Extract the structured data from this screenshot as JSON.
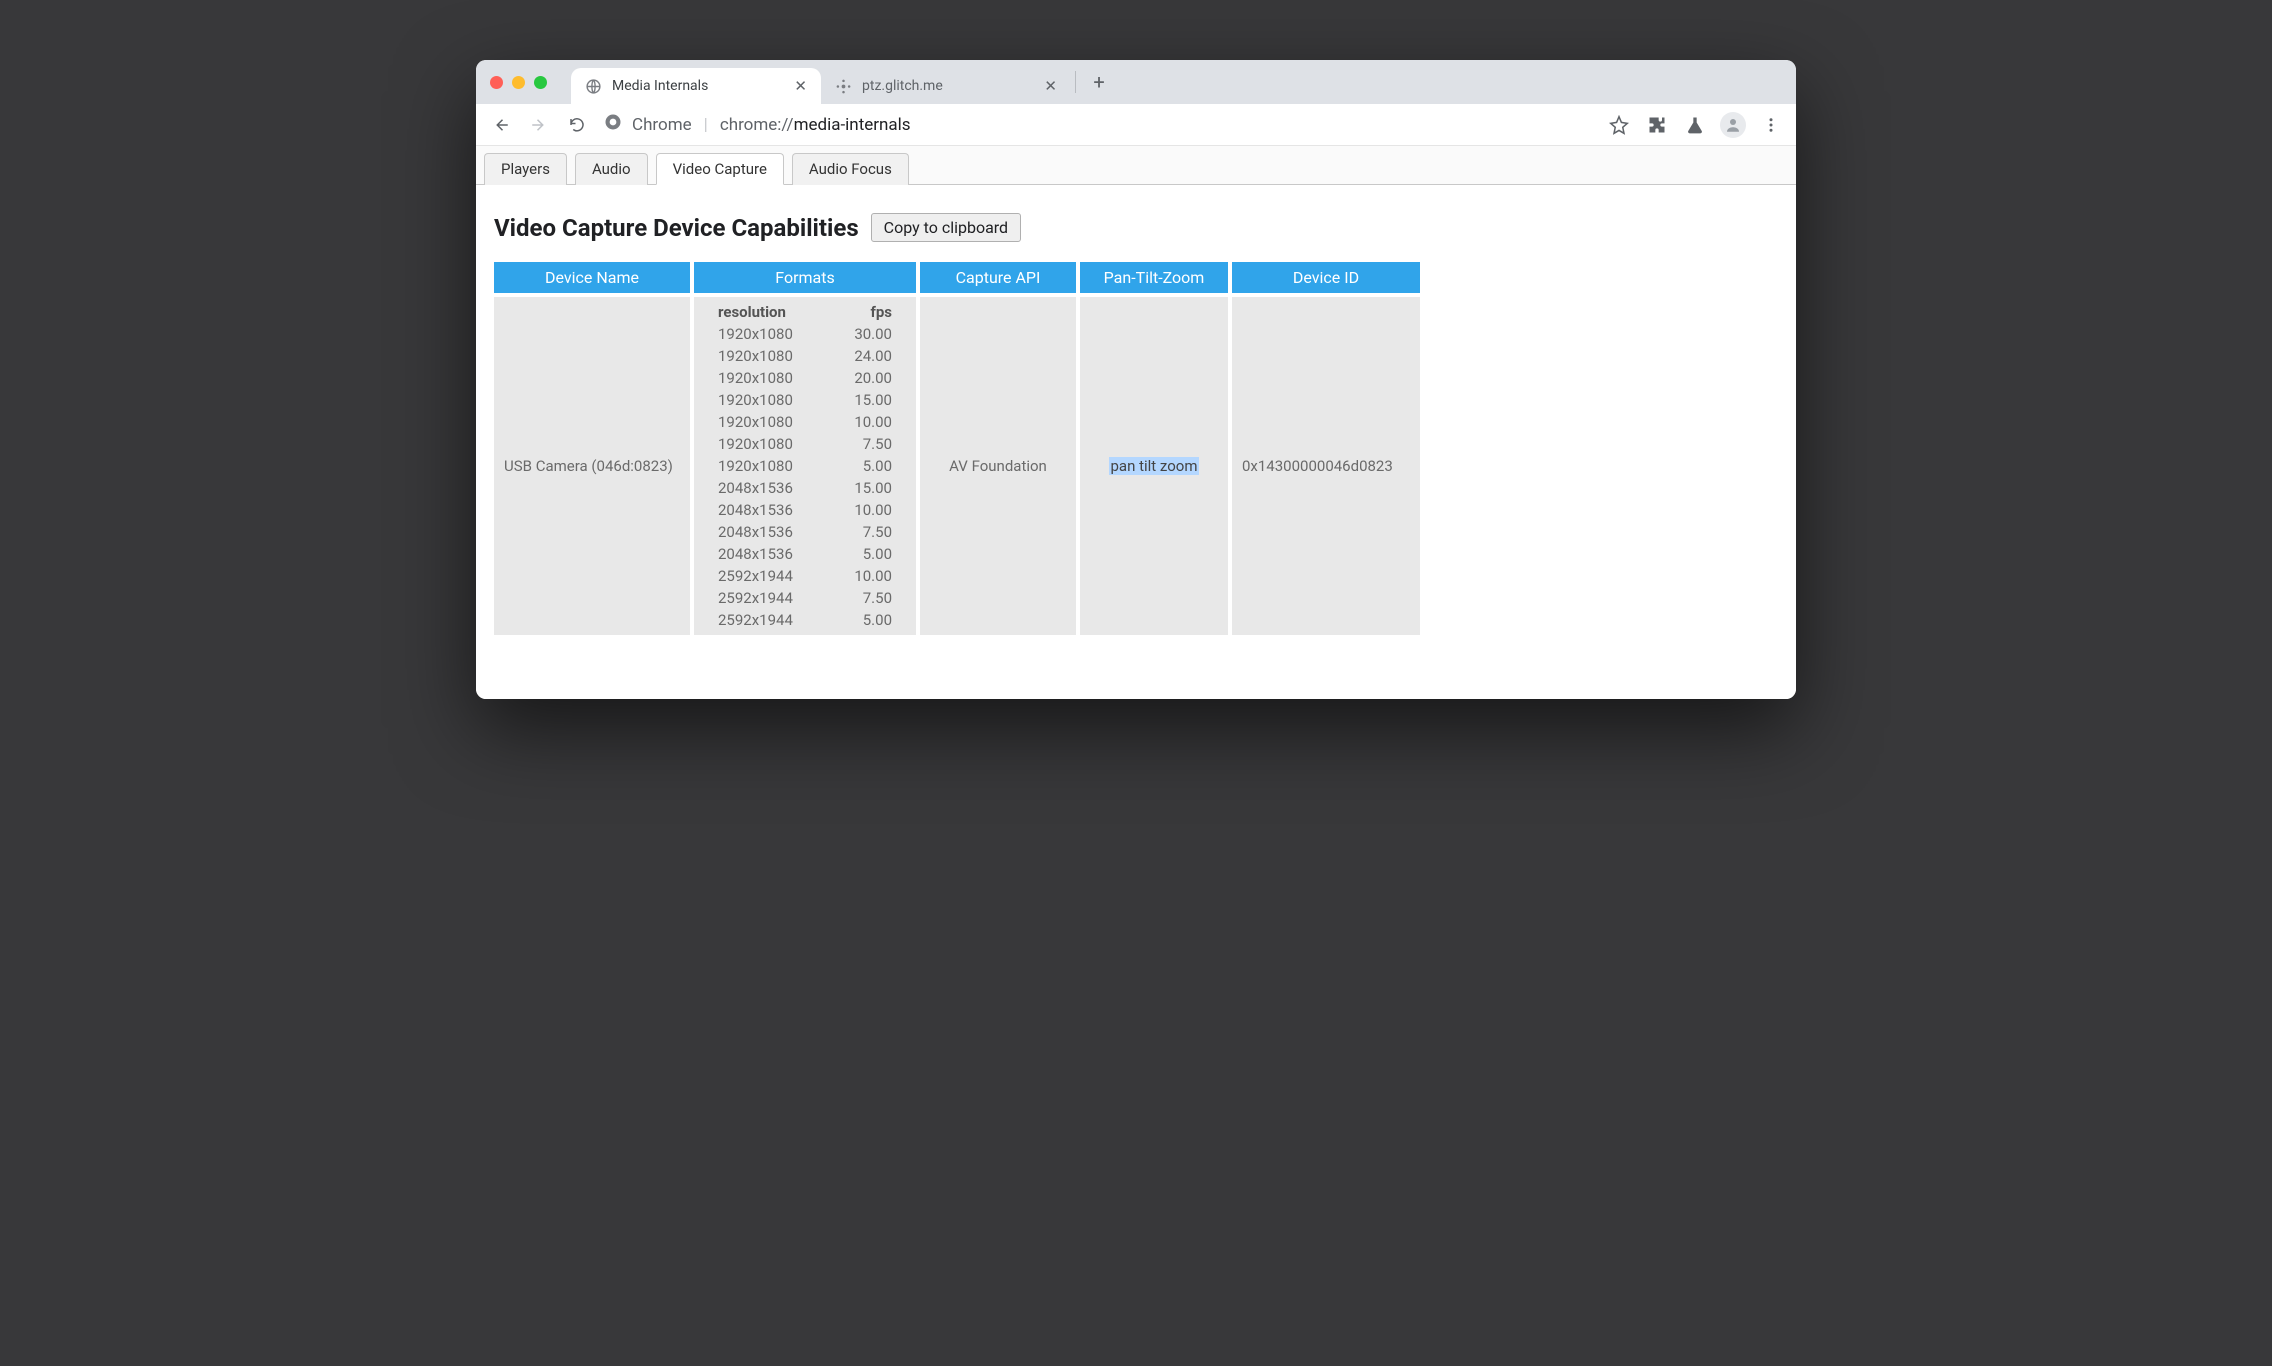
{
  "browser": {
    "tabs": [
      {
        "title": "Media Internals",
        "active": true,
        "favicon": "chrome-icon"
      },
      {
        "title": "ptz.glitch.me",
        "active": false,
        "favicon": "glitch-icon"
      }
    ],
    "url": {
      "scheme_label": "Chrome",
      "scheme": "chrome://",
      "path": "media-internals"
    }
  },
  "page_tabs": [
    {
      "label": "Players",
      "selected": false
    },
    {
      "label": "Audio",
      "selected": false
    },
    {
      "label": "Video Capture",
      "selected": true
    },
    {
      "label": "Audio Focus",
      "selected": false
    }
  ],
  "heading": "Video Capture Device Capabilities",
  "copy_button": "Copy to clipboard",
  "table": {
    "columns": [
      "Device Name",
      "Formats",
      "Capture API",
      "Pan-Tilt-Zoom",
      "Device ID"
    ],
    "formats_header": {
      "resolution": "resolution",
      "fps": "fps"
    },
    "row": {
      "device_name": "USB Camera (046d:0823)",
      "capture_api": "AV Foundation",
      "ptz": "pan tilt zoom",
      "device_id": "0x14300000046d0823",
      "formats": [
        {
          "resolution": "1920x1080",
          "fps": "30.00"
        },
        {
          "resolution": "1920x1080",
          "fps": "24.00"
        },
        {
          "resolution": "1920x1080",
          "fps": "20.00"
        },
        {
          "resolution": "1920x1080",
          "fps": "15.00"
        },
        {
          "resolution": "1920x1080",
          "fps": "10.00"
        },
        {
          "resolution": "1920x1080",
          "fps": "7.50"
        },
        {
          "resolution": "1920x1080",
          "fps": "5.00"
        },
        {
          "resolution": "2048x1536",
          "fps": "15.00"
        },
        {
          "resolution": "2048x1536",
          "fps": "10.00"
        },
        {
          "resolution": "2048x1536",
          "fps": "7.50"
        },
        {
          "resolution": "2048x1536",
          "fps": "5.00"
        },
        {
          "resolution": "2592x1944",
          "fps": "10.00"
        },
        {
          "resolution": "2592x1944",
          "fps": "7.50"
        },
        {
          "resolution": "2592x1944",
          "fps": "5.00"
        }
      ]
    }
  }
}
